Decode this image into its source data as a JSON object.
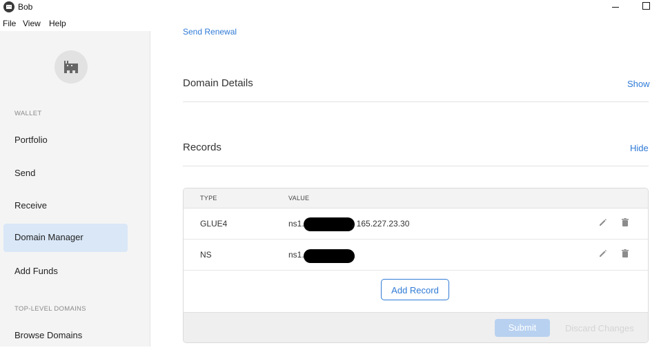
{
  "window": {
    "title": "Bob"
  },
  "menu": [
    "File",
    "View",
    "Help"
  ],
  "sidebar": {
    "wallet_label": "WALLET",
    "items": [
      {
        "label": "Portfolio",
        "active": false
      },
      {
        "label": "Send",
        "active": false
      },
      {
        "label": "Receive",
        "active": false
      },
      {
        "label": "Domain Manager",
        "active": true
      },
      {
        "label": "Add Funds",
        "active": false
      }
    ],
    "tld_label": "TOP-LEVEL DOMAINS",
    "tld_items": [
      {
        "label": "Browse Domains"
      }
    ]
  },
  "main": {
    "send_renewal": "Send Renewal",
    "domain_details": {
      "title": "Domain Details",
      "toggle": "Show"
    },
    "records": {
      "title": "Records",
      "toggle": "Hide",
      "columns": [
        "TYPE",
        "VALUE"
      ],
      "rows": [
        {
          "type": "GLUE4",
          "value_prefix": "ns1.",
          "value_suffix": ". 165.227.23.30"
        },
        {
          "type": "NS",
          "value_prefix": "ns1.",
          "value_suffix": "."
        }
      ],
      "add_label": "Add Record",
      "submit_label": "Submit",
      "discard_label": "Discard Changes"
    }
  },
  "colors": {
    "accent": "#2f7ad6",
    "active_nav": "#d9e7f7",
    "sidebar_bg": "#f4f4f4"
  }
}
